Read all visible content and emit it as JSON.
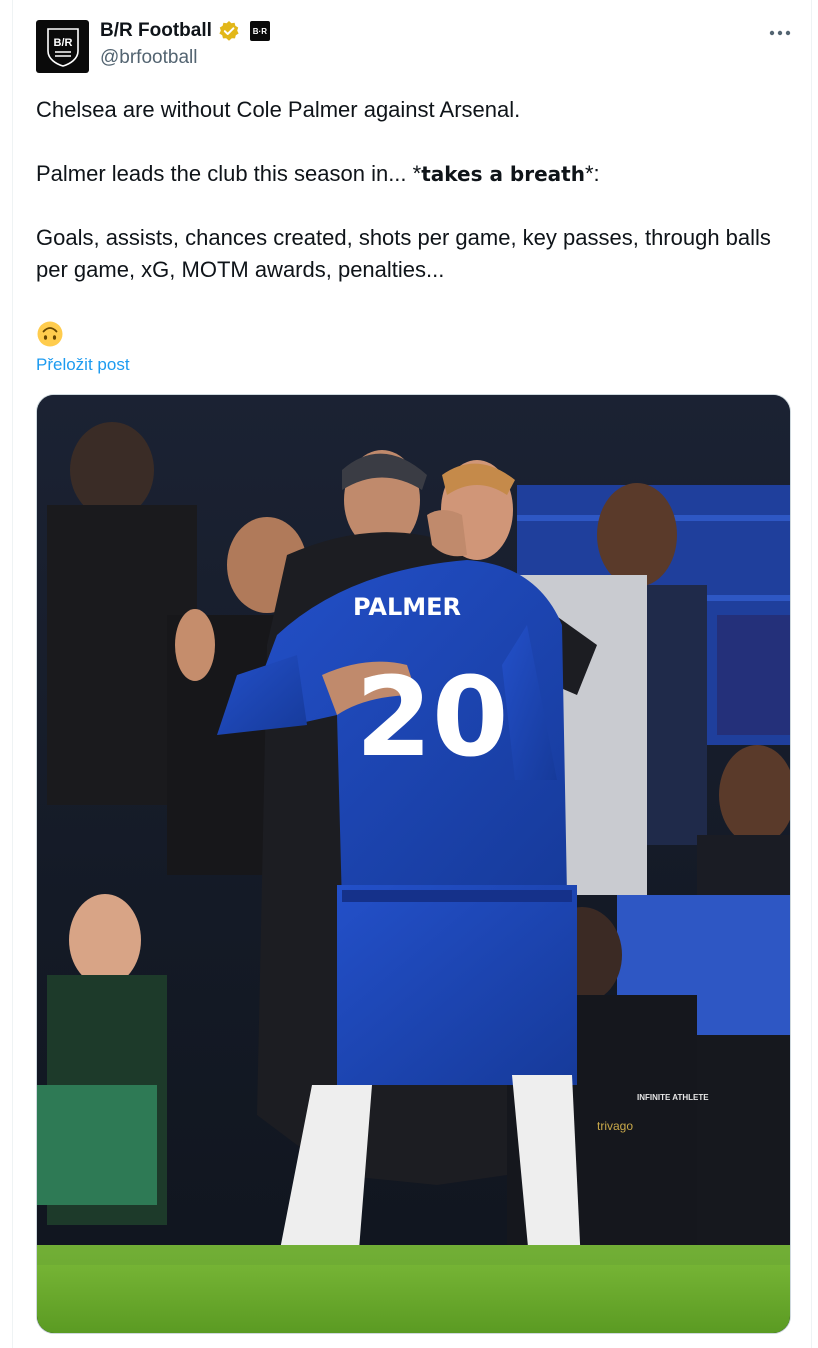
{
  "post": {
    "display_name": "B/R Football",
    "handle": "@brfootball",
    "avatar_logo_text": "B/R",
    "affiliate_badge_text": "B·R",
    "more_icon": "more-horizontal-icon",
    "verified_icon": "verified-badge-icon",
    "verified_color": "#e2b719",
    "text_line_1": "Chelsea are without Cole Palmer against Arsenal.",
    "text_line_2_prefix": "Palmer leads the club this season in... *",
    "text_line_2_bold": "takes a breath",
    "text_line_2_suffix": "*:",
    "text_line_3": "Goals, assists, chances created, shots per game, key passes, through balls per game, xG, MOTM awards, penalties...",
    "emoji": "upside-down-face-emoji",
    "translate_link": "Přeložit post",
    "link_color": "#1d9bf0"
  },
  "media": {
    "jersey_name": "PALMER",
    "jersey_number": "20",
    "sponsor_text": "trivago",
    "kit_brand_text": "INFINITE ATHLETE",
    "kit_color": "#1a3fa8"
  }
}
